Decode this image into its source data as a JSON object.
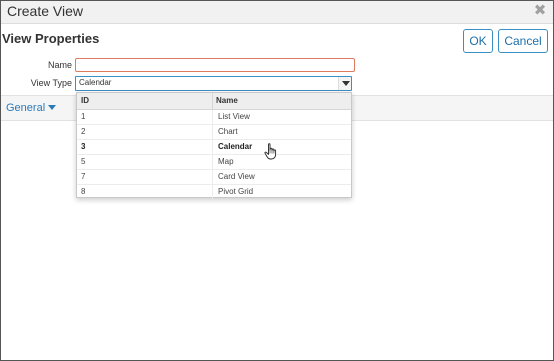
{
  "dialog": {
    "title": "Create View",
    "close_icon": "close-icon"
  },
  "header": {
    "section_title": "View Properties",
    "ok_label": "OK",
    "cancel_label": "Cancel"
  },
  "form": {
    "name_label": "Name",
    "name_value": "",
    "view_type_label": "View Type",
    "view_type_value": "Calendar"
  },
  "tabs": {
    "general_label": "General",
    "caret_icon": "caret-down-icon"
  },
  "dropdown": {
    "columns": {
      "id": "ID",
      "name": "Name"
    },
    "rows": [
      {
        "id": "1",
        "name": "List View"
      },
      {
        "id": "2",
        "name": "Chart"
      },
      {
        "id": "3",
        "name": "Calendar"
      },
      {
        "id": "5",
        "name": "Map"
      },
      {
        "id": "7",
        "name": "Card View"
      },
      {
        "id": "8",
        "name": "Pivot Grid"
      }
    ],
    "selected_index": 2
  },
  "cursor": {
    "icon": "hand-pointer-icon"
  },
  "colors": {
    "accent": "#2a7ab8",
    "button_border": "#3b8fc4",
    "invalid_border": "#e07a5f"
  }
}
